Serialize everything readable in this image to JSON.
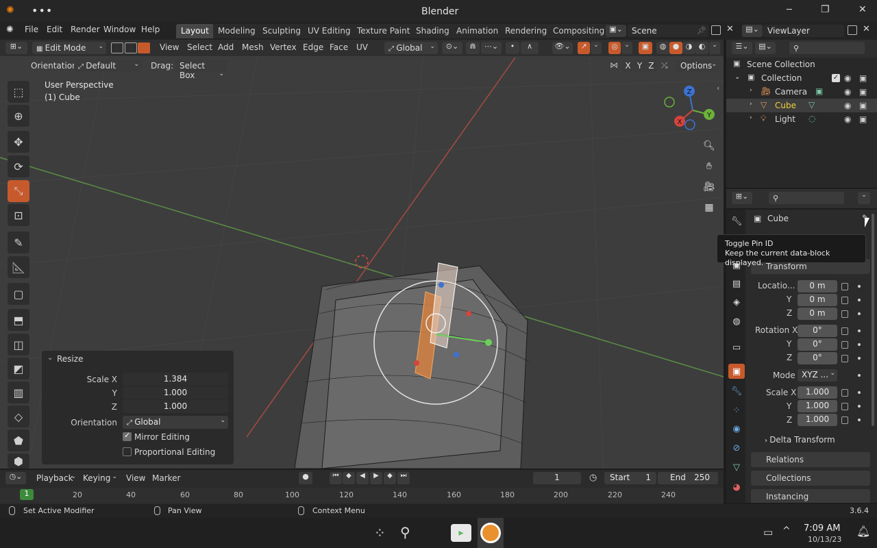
{
  "window": {
    "title": "Blender",
    "min": "─",
    "max": "❐",
    "close": "✕"
  },
  "menus": [
    "File",
    "Edit",
    "Render",
    "Window",
    "Help"
  ],
  "workspaces": [
    {
      "label": "Layout",
      "active": true
    },
    {
      "label": "Modeling"
    },
    {
      "label": "Sculpting"
    },
    {
      "label": "UV Editing"
    },
    {
      "label": "Texture Paint"
    },
    {
      "label": "Shading"
    },
    {
      "label": "Animation"
    },
    {
      "label": "Rendering"
    },
    {
      "label": "Compositing"
    }
  ],
  "scene": {
    "label": "Scene"
  },
  "view_layer": {
    "label": "ViewLayer"
  },
  "header": {
    "mode": "Edit Mode",
    "menus": [
      "View",
      "Select",
      "Add",
      "Mesh",
      "Vertex",
      "Edge",
      "Face",
      "UV"
    ],
    "transform_orientation": "Global",
    "orientation_label": "Orientation:",
    "orientation_value": "Default",
    "drag_label": "Drag:",
    "drag_value": "Select Box",
    "axes": [
      "X",
      "Y",
      "Z"
    ],
    "options": "Options"
  },
  "viewport": {
    "view_name": "User Perspective",
    "object": "(1) Cube"
  },
  "gizmo": {
    "x": "X",
    "y": "Y",
    "z": "Z"
  },
  "resize_panel": {
    "title": "Resize",
    "scale_x_label": "Scale X",
    "scale_x": "1.384",
    "y_label": "Y",
    "y": "1.000",
    "z_label": "Z",
    "z": "1.000",
    "orientation_label": "Orientation",
    "orientation": "Global",
    "mirror": "Mirror Editing",
    "mirror_on": true,
    "proportional": "Proportional Editing",
    "proportional_on": false
  },
  "outliner": {
    "root": "Scene Collection",
    "collection": "Collection",
    "items": [
      {
        "label": "Camera"
      },
      {
        "label": "Cube",
        "active": true
      },
      {
        "label": "Light"
      }
    ]
  },
  "properties": {
    "object": "Cube",
    "transform": "Transform",
    "location_label": "Locatio...",
    "loc_x": "0 m",
    "loc_y": "0 m",
    "loc_z": "0 m",
    "rotation_label": "Rotation X",
    "rot_x": "0°",
    "rot_y": "0°",
    "rot_z": "0°",
    "mode_label": "Mode",
    "mode": "XYZ ...",
    "scale_label": "Scale X",
    "scale_x": "1.000",
    "scale_y": "1.000",
    "scale_z": "1.000",
    "y": "Y",
    "z": "Z",
    "delta": "Delta Transform",
    "relations": "Relations",
    "collections": "Collections",
    "instancing": "Instancing"
  },
  "tooltip": {
    "title": "Toggle Pin ID",
    "body": "Keep the current data-block displayed."
  },
  "timeline": {
    "playback": "Playback",
    "keying": "Keying",
    "view": "View",
    "marker": "Marker",
    "current_frame": "1",
    "start_label": "Start",
    "start": "1",
    "end_label": "End",
    "end": "250",
    "ticks": [
      "1",
      "20",
      "40",
      "60",
      "80",
      "100",
      "120",
      "140",
      "160",
      "180",
      "200",
      "220",
      "240"
    ]
  },
  "status": {
    "left": "Set Active Modifier",
    "mid": "Pan View",
    "right": "Context Menu",
    "version": "3.6.4"
  },
  "taskbar": {
    "time": "7:09 AM",
    "date": "10/13/23"
  },
  "colors": {
    "accent": "#c75a2c",
    "x_axis": "#d5443c",
    "y_axis": "#6bb13a",
    "z_axis": "#3c72d5",
    "selected_text": "#f1d13a"
  }
}
